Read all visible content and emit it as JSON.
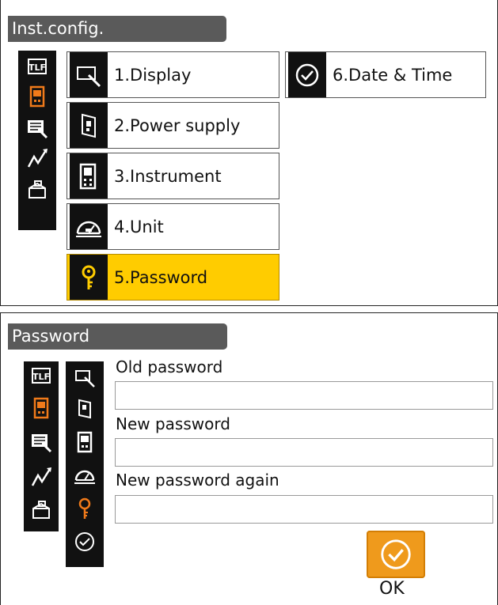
{
  "screen1": {
    "title": "Inst.config.",
    "menu": [
      {
        "label": "1.Display",
        "icon": "display-icon"
      },
      {
        "label": "2.Power supply",
        "icon": "power-supply-icon"
      },
      {
        "label": "3.Instrument",
        "icon": "instrument-icon"
      },
      {
        "label": "4.Unit",
        "icon": "unit-icon"
      },
      {
        "label": "5.Password",
        "icon": "key-icon",
        "selected": true
      },
      {
        "label": "6.Date & Time",
        "icon": "clock-icon"
      }
    ],
    "sidebar_icons": [
      "card-icon",
      "instrument-icon",
      "display-pen-icon",
      "graph-icon",
      "box-icon"
    ]
  },
  "screen2": {
    "title": "Password",
    "fields": [
      {
        "label": "Old password",
        "value": ""
      },
      {
        "label": "New password",
        "value": ""
      },
      {
        "label": "New password again",
        "value": ""
      }
    ],
    "ok_label": "OK"
  },
  "colors": {
    "selected": "#ffcc00",
    "active_icon": "#f07a1a",
    "ok_button": "#ef9a1c",
    "titlebar": "#5a5a5a"
  }
}
